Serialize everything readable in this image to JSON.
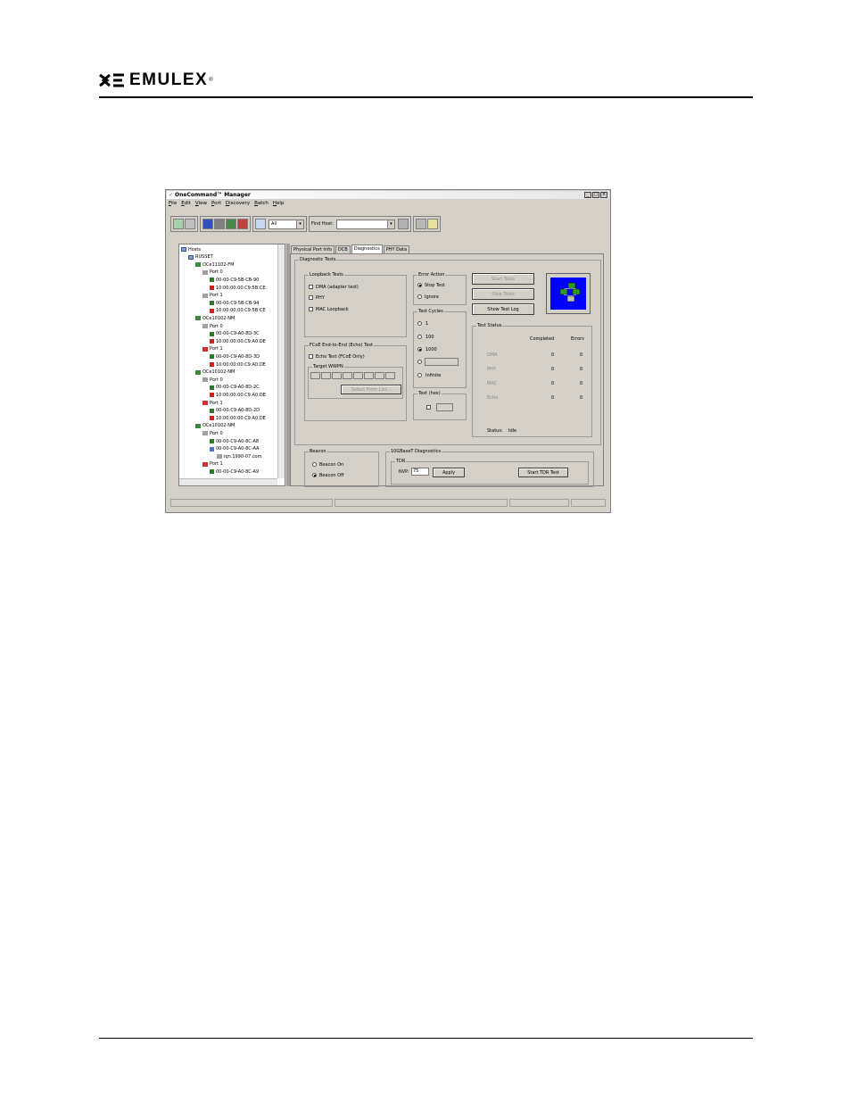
{
  "page": {
    "brand": "EMULEX",
    "brand_mark": "®"
  },
  "window": {
    "title": "OneCommand™ Manager",
    "controls": [
      "_",
      "□",
      "×"
    ],
    "menu": [
      "File",
      "Edit",
      "View",
      "Port",
      "Discovery",
      "Batch",
      "Help"
    ],
    "toolbar": {
      "filter_value": "All",
      "find_host_label": "Find Host:",
      "find_host_value": ""
    }
  },
  "tree": {
    "rows": [
      {
        "label": "Hosts",
        "icon": "host-icon",
        "level": 0
      },
      {
        "label": "RUSSET",
        "icon": "host-icon",
        "level": 1
      },
      {
        "label": "OCe11102-FM",
        "icon": "adapter-icon",
        "level": 2
      },
      {
        "label": "Port 0",
        "icon": "port-icon",
        "level": 3
      },
      {
        "label": "00-00-C9-5B-CB-90",
        "icon": "nic-icon",
        "level": 4
      },
      {
        "label": "10:00:00:00:C9:5B:CE",
        "icon": "fcoe-icon",
        "level": 4
      },
      {
        "label": "Port 1",
        "icon": "port-icon",
        "level": 3
      },
      {
        "label": "00-00-C9-5B-CB-94",
        "icon": "nic-icon",
        "level": 4
      },
      {
        "label": "10:00:00:00:C9:5B:CE",
        "icon": "fcoe-icon",
        "level": 4
      },
      {
        "label": "OCe10102-NM",
        "icon": "adapter-icon",
        "level": 2
      },
      {
        "label": "Port 0",
        "icon": "port-icon",
        "level": 3
      },
      {
        "label": "00-00-C9-A0-8D-3C",
        "icon": "nic-icon",
        "level": 4
      },
      {
        "label": "10:00:00:00:C9:A0:DE",
        "icon": "fcoe-icon",
        "level": 4
      },
      {
        "label": "Port 1",
        "icon": "port-down-icon",
        "level": 3
      },
      {
        "label": "00-00-C9-A0-8D-3D",
        "icon": "nic-icon",
        "level": 4
      },
      {
        "label": "10:00:00:00:C9:A0:DE",
        "icon": "fcoe-icon",
        "level": 4
      },
      {
        "label": "OCe10102-NM",
        "icon": "adapter-icon",
        "level": 2
      },
      {
        "label": "Port 0",
        "icon": "port-icon",
        "level": 3
      },
      {
        "label": "00-00-C9-A0-8D-2C",
        "icon": "nic-icon",
        "level": 4
      },
      {
        "label": "10:00:00:00:C9:A0:DE",
        "icon": "fcoe-icon",
        "level": 4
      },
      {
        "label": "Port 1",
        "icon": "port-down-icon",
        "level": 3
      },
      {
        "label": "00-00-C9-A0-8D-2D",
        "icon": "nic-icon",
        "level": 4
      },
      {
        "label": "10:00:00:00:C9:A0:DE",
        "icon": "fcoe-icon",
        "level": 4
      },
      {
        "label": "OCe10102-NM",
        "icon": "adapter-icon",
        "level": 2
      },
      {
        "label": "Port 0",
        "icon": "port-icon",
        "level": 3
      },
      {
        "label": "00-00-C9-A0-8C-A8",
        "icon": "nic-icon",
        "level": 4
      },
      {
        "label": "00-00-C9-A0-8C-AA",
        "icon": "iscsi-icon",
        "level": 4
      },
      {
        "label": "iqn.1990-07.com",
        "icon": "target-icon",
        "level": 5
      },
      {
        "label": "Port 1",
        "icon": "port-down-icon",
        "level": 3
      },
      {
        "label": "00-00-C9-A0-8C-A9",
        "icon": "nic-icon",
        "level": 4
      }
    ]
  },
  "tabs": [
    "Physical Port Info",
    "DCB",
    "Diagnostics",
    "PHY Data"
  ],
  "diagnostics": {
    "group_title": "Diagnostic Tests",
    "loopback": {
      "title": "Loopback Tests",
      "options": [
        "DMA (adapter test)",
        "PHY",
        "MAC Loopback"
      ]
    },
    "echo": {
      "title": "FCoE End-to-End (Echo) Test",
      "option": "Echo Test (FCoE Only)",
      "target_label": "Target WWPN",
      "select_button": "Select From List..."
    },
    "error_action": {
      "title": "Error Action",
      "options": [
        "Stop Test",
        "Ignore"
      ],
      "selected": "Stop Test"
    },
    "test_cycles": {
      "title": "Test Cycles",
      "options": [
        "1",
        "100",
        "1000",
        "",
        "Infinite"
      ],
      "selected": "1000"
    },
    "test_hex": {
      "title": "Text (hex)"
    },
    "buttons": {
      "start": "Start Tests",
      "stop": "Stop Tests",
      "show_log": "Show Test Log"
    },
    "test_status": {
      "title": "Test Status",
      "headers": [
        "Completed",
        "Errors"
      ],
      "rows": [
        {
          "name": "DMA",
          "completed": "0",
          "errors": "0"
        },
        {
          "name": "PHY",
          "completed": "0",
          "errors": "0"
        },
        {
          "name": "MAC",
          "completed": "0",
          "errors": "0"
        },
        {
          "name": "Echo",
          "completed": "0",
          "errors": "0"
        }
      ],
      "status_label": "Status:",
      "status_value": "Idle"
    },
    "beacon": {
      "title": "Beacon",
      "options": [
        "Beacon On",
        "Beacon Off"
      ],
      "selected": "Beacon Off"
    },
    "tdr": {
      "title": "10GBaseT Diagnostics",
      "subtitle": "TDR",
      "nvp_label": "NVP:",
      "nvp_value": "75",
      "apply": "Apply",
      "start_tdr": "Start TDR Test"
    }
  },
  "colors": {
    "window_bg": "#d4d0c8",
    "graphic_bg": "#0000ff"
  }
}
